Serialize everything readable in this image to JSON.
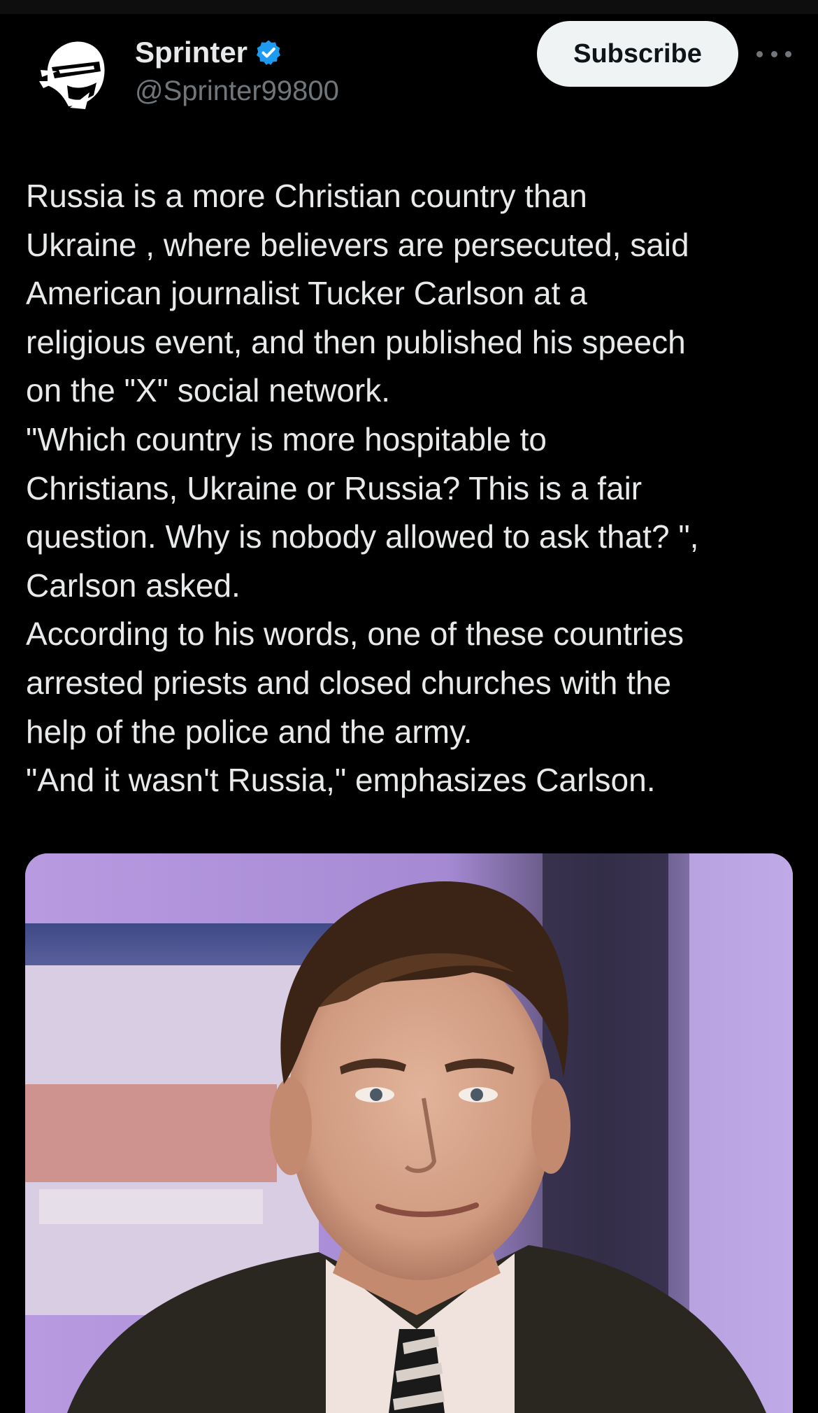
{
  "author": {
    "display_name": "Sprinter",
    "handle": "@Sprinter99800",
    "verified": true,
    "avatar_icon": "ninja-helmet-logo"
  },
  "actions": {
    "subscribe_label": "Subscribe",
    "more_icon": "more-horizontal-icon"
  },
  "post": {
    "lines": [
      "Russia is a more Christian country than",
      "Ukraine , where believers are persecuted, said",
      "American journalist Tucker Carlson at a",
      "religious event, and then published his speech",
      "on the \"X\" social network.",
      " \"Which country is more hospitable to",
      "Christians, Ukraine or Russia? This is a fair",
      "question. Why is nobody allowed to ask that? \",",
      "Carlson asked.",
      "According to his words, one of these countries",
      "arrested priests and closed churches with the",
      "help of the police and the army.",
      " \"And it wasn't Russia,\" emphasizes Carlson."
    ]
  },
  "media": {
    "type": "photo"
  },
  "colors": {
    "background": "#000000",
    "text_primary": "#e7e9ea",
    "text_secondary": "#71767b",
    "verified_blue": "#1d9bf0",
    "subscribe_bg": "#eff3f4"
  }
}
